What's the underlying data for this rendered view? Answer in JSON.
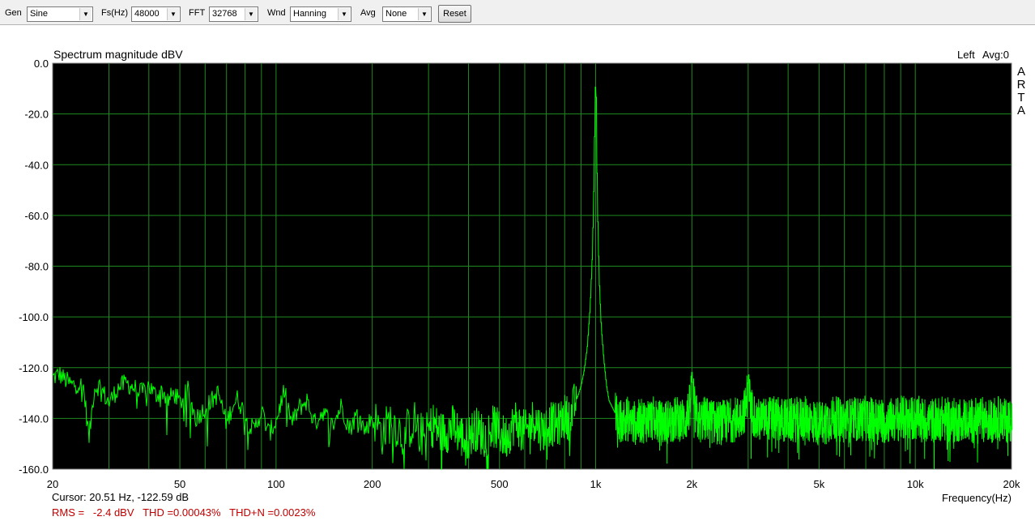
{
  "toolbar": {
    "gen_label": "Gen",
    "gen_value": "Sine",
    "fs_label": "Fs(Hz)",
    "fs_value": "48000",
    "fft_label": "FFT",
    "fft_value": "32768",
    "wnd_label": "Wnd",
    "wnd_value": "Hanning",
    "avg_label": "Avg",
    "avg_value": "None",
    "reset_label": "Reset"
  },
  "chart": {
    "channel_label": "Left",
    "avg_label": "Avg:0",
    "side_brand": [
      "A",
      "R",
      "T",
      "A"
    ],
    "cursor_text": "Cursor: 20.51 Hz, -122.59 dB",
    "status_text": "RMS =   -2.4 dBV   THD =0.00043%   THD+N =0.0023%"
  },
  "chart_data": {
    "type": "line",
    "title": "Spectrum magnitude dBV",
    "xlabel": "Frequency(Hz)",
    "ylabel": "",
    "xscale": "log",
    "xlim": [
      20,
      20000
    ],
    "ylim": [
      -160,
      0
    ],
    "x_ticks": [
      20,
      50,
      100,
      200,
      500,
      1000,
      2000,
      5000,
      10000,
      20000
    ],
    "x_tick_labels": [
      "20",
      "50",
      "100",
      "200",
      "500",
      "1k",
      "2k",
      "5k",
      "10k",
      "20k"
    ],
    "y_ticks": [
      0,
      -20,
      -40,
      -60,
      -80,
      -100,
      -120,
      -140,
      -160
    ],
    "y_tick_labels": [
      "0.0",
      "-20.0",
      "-40.0",
      "-60.0",
      "-80.0",
      "-100.0",
      "-120.0",
      "-140.0",
      "-160.0"
    ],
    "grid": true,
    "background": "#000000",
    "grid_color": "#1f8a1f",
    "series": [
      {
        "color": "#00ff00",
        "x": [
          20,
          21,
          22,
          23,
          24,
          25,
          26,
          27,
          28,
          30,
          32,
          34,
          36,
          38,
          40,
          42,
          44,
          46,
          48,
          50,
          53,
          56,
          60,
          63,
          66,
          70,
          73,
          76,
          80,
          85,
          90,
          95,
          100,
          106,
          112,
          118,
          125,
          132,
          140,
          150,
          160,
          170,
          180,
          190,
          200,
          215,
          230,
          250,
          270,
          290,
          310,
          330,
          360,
          390,
          420,
          450,
          480,
          520,
          560,
          600,
          640,
          680,
          720,
          760,
          800,
          830,
          860,
          880,
          900,
          920,
          940,
          960,
          975,
          985,
          993,
          998,
          1000,
          1002,
          1007,
          1015,
          1025,
          1040,
          1060,
          1080,
          1100,
          1130,
          1160,
          1200,
          1250,
          1300,
          1400,
          1500,
          1600,
          1700,
          1800,
          1900,
          1960,
          1990,
          2000,
          2010,
          2040,
          2100,
          2200,
          2400,
          2600,
          2800,
          2950,
          3000,
          3050,
          3200,
          3500,
          4000,
          4500,
          5000,
          5500,
          6000,
          7000,
          8000,
          9000,
          10000,
          11000,
          12000,
          13000,
          14000,
          15000,
          16000,
          17000,
          18000,
          19000,
          20000
        ],
        "y": [
          -124,
          -122.6,
          -125,
          -127,
          -126,
          -128,
          -148,
          -128,
          -127,
          -134,
          -128,
          -126,
          -128,
          -130,
          -127,
          -131,
          -129,
          -133,
          -130,
          -134,
          -129,
          -140,
          -136,
          -133,
          -130,
          -142,
          -135,
          -132,
          -139,
          -145,
          -137,
          -146,
          -141,
          -129,
          -142,
          -136,
          -133,
          -142,
          -137,
          -143,
          -135,
          -144,
          -138,
          -145,
          -139,
          -146,
          -140,
          -147,
          -141,
          -148,
          -142,
          -146,
          -143,
          -149,
          -144,
          -147,
          -143,
          -148,
          -141,
          -146,
          -140,
          -145,
          -142,
          -143,
          -139,
          -140,
          -134,
          -131,
          -127,
          -121,
          -112,
          -96,
          -76,
          -52,
          -22,
          -6,
          -3,
          -9,
          -38,
          -64,
          -86,
          -104,
          -117,
          -127,
          -133,
          -136,
          -139,
          -141,
          -140,
          -142,
          -141,
          -140,
          -142,
          -141,
          -140,
          -141,
          -136,
          -128,
          -118,
          -128,
          -138,
          -141,
          -140,
          -142,
          -141,
          -140,
          -136,
          -122,
          -136,
          -141,
          -140,
          -141,
          -140,
          -142,
          -140,
          -141,
          -140,
          -141,
          -140,
          -140,
          -141,
          -140,
          -141,
          -140,
          -141,
          -140,
          -141,
          -140,
          -141,
          -140
        ],
        "noise_floor_band": [
          -150,
          -128
        ]
      }
    ]
  }
}
